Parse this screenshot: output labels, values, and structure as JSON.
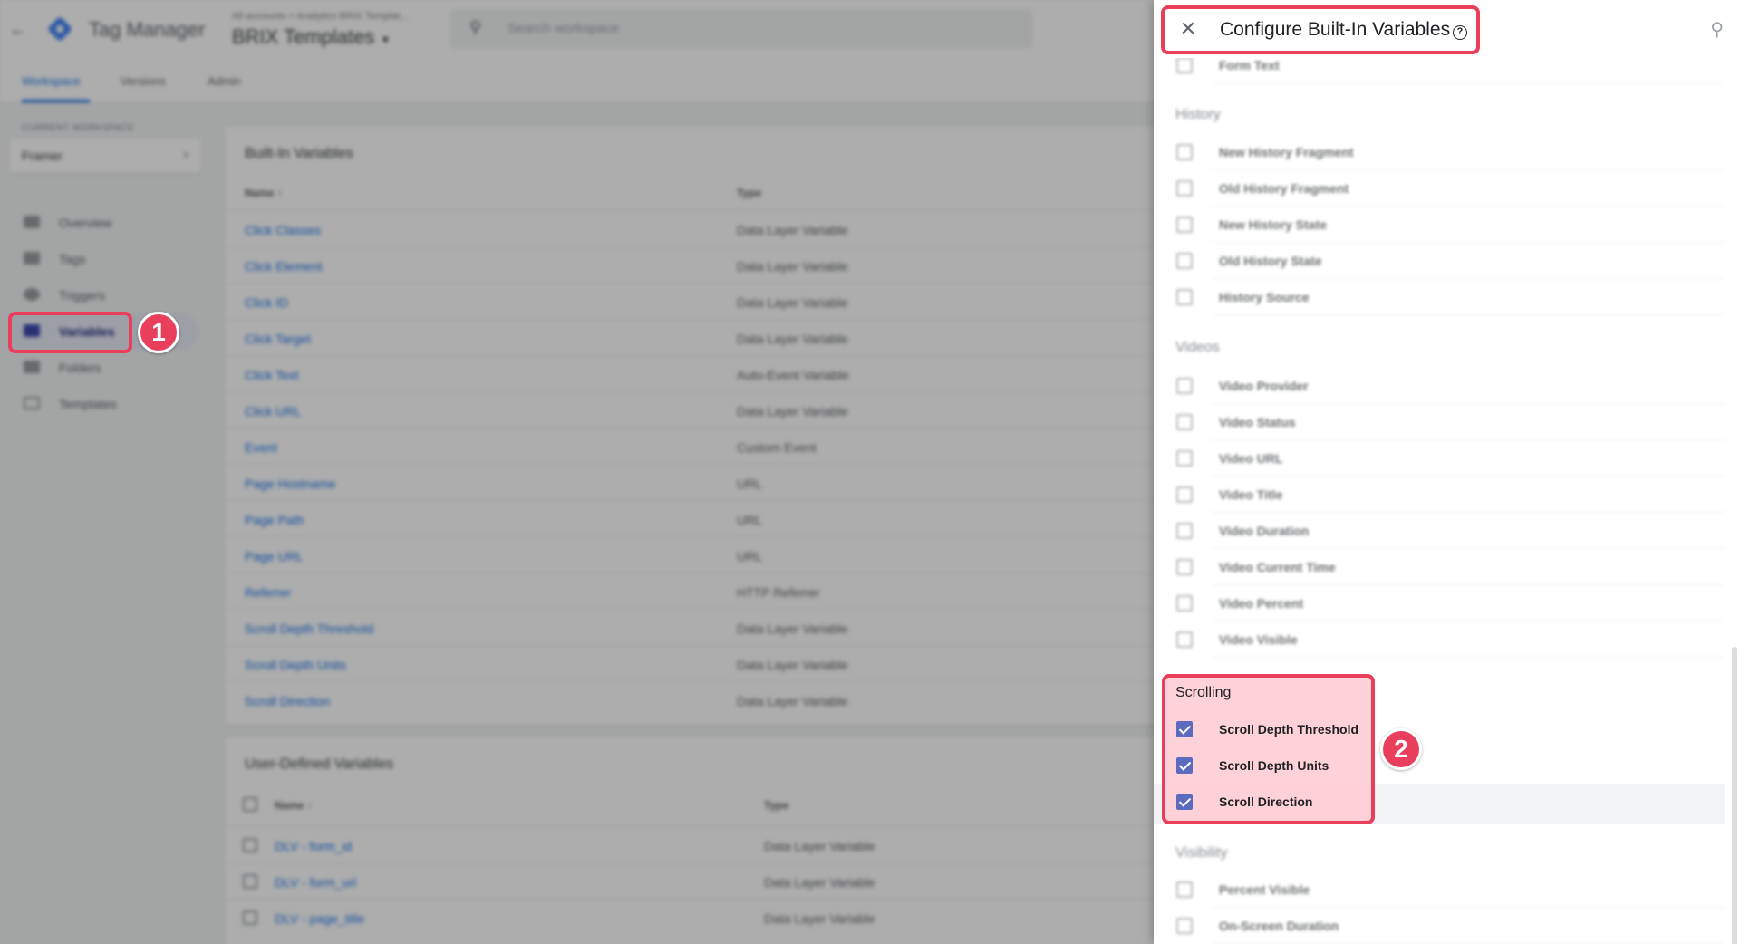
{
  "app": {
    "product_name": "Tag Manager",
    "breadcrumb": "All accounts > Analytics BRIX Templat...",
    "container_name": "BRIX Templates",
    "search_placeholder": "Search workspace"
  },
  "tabs": [
    {
      "label": "Workspace",
      "active": true
    },
    {
      "label": "Versions",
      "active": false
    },
    {
      "label": "Admin",
      "active": false
    }
  ],
  "sidebar": {
    "workspace_label": "CURRENT WORKSPACE",
    "workspace_name": "Framer",
    "items": [
      {
        "label": "Overview",
        "icon": "overview-icon",
        "active": false
      },
      {
        "label": "Tags",
        "icon": "tag-icon",
        "active": false
      },
      {
        "label": "Triggers",
        "icon": "trigger-icon",
        "active": false
      },
      {
        "label": "Variables",
        "icon": "variables-icon",
        "active": true
      },
      {
        "label": "Folders",
        "icon": "folder-icon",
        "active": false
      },
      {
        "label": "Templates",
        "icon": "template-icon",
        "active": false
      }
    ]
  },
  "builtin_card": {
    "title": "Built-In Variables",
    "col_name": "Name ↑",
    "col_type": "Type",
    "rows": [
      {
        "name": "Click Classes",
        "type": "Data Layer Variable"
      },
      {
        "name": "Click Element",
        "type": "Data Layer Variable"
      },
      {
        "name": "Click ID",
        "type": "Data Layer Variable"
      },
      {
        "name": "Click Target",
        "type": "Data Layer Variable"
      },
      {
        "name": "Click Text",
        "type": "Auto-Event Variable"
      },
      {
        "name": "Click URL",
        "type": "Data Layer Variable"
      },
      {
        "name": "Event",
        "type": "Custom Event"
      },
      {
        "name": "Page Hostname",
        "type": "URL"
      },
      {
        "name": "Page Path",
        "type": "URL"
      },
      {
        "name": "Page URL",
        "type": "URL"
      },
      {
        "name": "Referrer",
        "type": "HTTP Referrer"
      },
      {
        "name": "Scroll Depth Threshold",
        "type": "Data Layer Variable"
      },
      {
        "name": "Scroll Depth Units",
        "type": "Data Layer Variable"
      },
      {
        "name": "Scroll Direction",
        "type": "Data Layer Variable"
      }
    ]
  },
  "user_card": {
    "title": "User-Defined Variables",
    "col_name": "Name ↑",
    "col_type": "Type",
    "rows": [
      {
        "name": "DLV - form_id",
        "type": "Data Layer Variable"
      },
      {
        "name": "DLV - form_url",
        "type": "Data Layer Variable"
      },
      {
        "name": "DLV - page_title",
        "type": "Data Layer Variable"
      }
    ]
  },
  "panel": {
    "title": "Configure Built-In Variables",
    "help_glyph": "?",
    "close_glyph": "✕",
    "search_glyph": "⚲",
    "partial_item": "Form Text",
    "sections": [
      {
        "title": "History",
        "items": [
          {
            "label": "New History Fragment",
            "checked": false
          },
          {
            "label": "Old History Fragment",
            "checked": false
          },
          {
            "label": "New History State",
            "checked": false
          },
          {
            "label": "Old History State",
            "checked": false
          },
          {
            "label": "History Source",
            "checked": false
          }
        ]
      },
      {
        "title": "Videos",
        "items": [
          {
            "label": "Video Provider",
            "checked": false
          },
          {
            "label": "Video Status",
            "checked": false
          },
          {
            "label": "Video URL",
            "checked": false
          },
          {
            "label": "Video Title",
            "checked": false
          },
          {
            "label": "Video Duration",
            "checked": false
          },
          {
            "label": "Video Current Time",
            "checked": false
          },
          {
            "label": "Video Percent",
            "checked": false
          },
          {
            "label": "Video Visible",
            "checked": false
          }
        ]
      },
      {
        "title": "Scrolling",
        "items": [
          {
            "label": "Scroll Depth Threshold",
            "checked": true
          },
          {
            "label": "Scroll Depth Units",
            "checked": true
          },
          {
            "label": "Scroll Direction",
            "checked": true
          }
        ]
      },
      {
        "title": "Visibility",
        "items": [
          {
            "label": "Percent Visible",
            "checked": false
          },
          {
            "label": "On-Screen Duration",
            "checked": false
          }
        ]
      }
    ]
  },
  "annotations": {
    "step1": "1",
    "step2": "2",
    "color": "#ea3f5c"
  }
}
